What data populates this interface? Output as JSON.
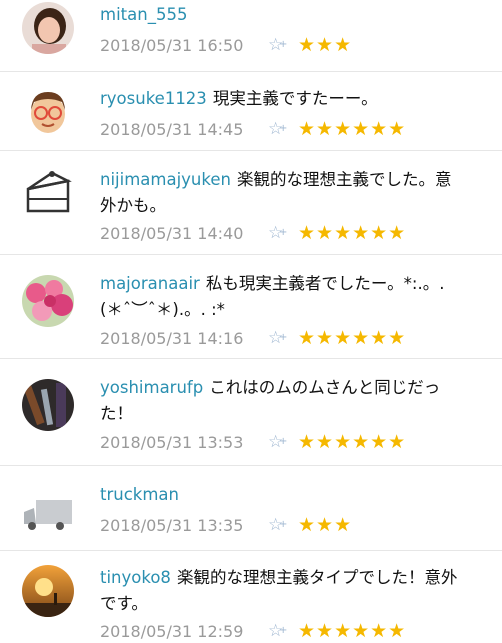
{
  "comments": [
    {
      "username": "mitan_555",
      "text": "",
      "time": "2018/05/31 16:50",
      "stars": "★★★",
      "star_count": 3,
      "avatar_icon": "woman-portrait-avatar"
    },
    {
      "username": "ryosuke1123",
      "text": "現実主義ですたーー。",
      "time": "2018/05/31 14:45",
      "stars": "★★★★★★",
      "star_count": 6,
      "avatar_icon": "cartoon-man-avatar"
    },
    {
      "username": "nijimamajyuken",
      "text": "楽観的な理想主義でした。意外かも。",
      "time": "2018/05/31 14:40",
      "stars": "★★★★★★",
      "star_count": 6,
      "avatar_icon": "cake-slice-avatar"
    },
    {
      "username": "majoranaair",
      "text": "私も現実主義者でしたー。*:.。.(＊ˆ︶ˆ＊).。. :*",
      "time": "2018/05/31 14:16",
      "stars": "★★★★★★",
      "star_count": 6,
      "avatar_icon": "flowers-avatar"
    },
    {
      "username": "yoshimarufp",
      "text": "これはのムのムさんと同じだった！",
      "time": "2018/05/31 13:53",
      "stars": "★★★★★★",
      "star_count": 6,
      "avatar_icon": "guitar-avatar"
    },
    {
      "username": "truckman",
      "text": "",
      "time": "2018/05/31 13:35",
      "stars": "★★★",
      "star_count": 3,
      "avatar_icon": "truck-avatar"
    },
    {
      "username": "tinyoko8",
      "text": "楽観的な理想主義タイプでした！意外です。",
      "time": "2018/05/31 12:59",
      "stars": "★★★★★★",
      "star_count": 6,
      "avatar_icon": "sunset-avatar"
    }
  ],
  "add_star_icon": "add-star-icon",
  "add_star_glyph": "☆",
  "add_star_plus": "+",
  "colors": {
    "username": "#2a8fb0",
    "star": "#f5b800",
    "timestamp": "#9a9a9a",
    "add_star": "#9fb7d1"
  }
}
